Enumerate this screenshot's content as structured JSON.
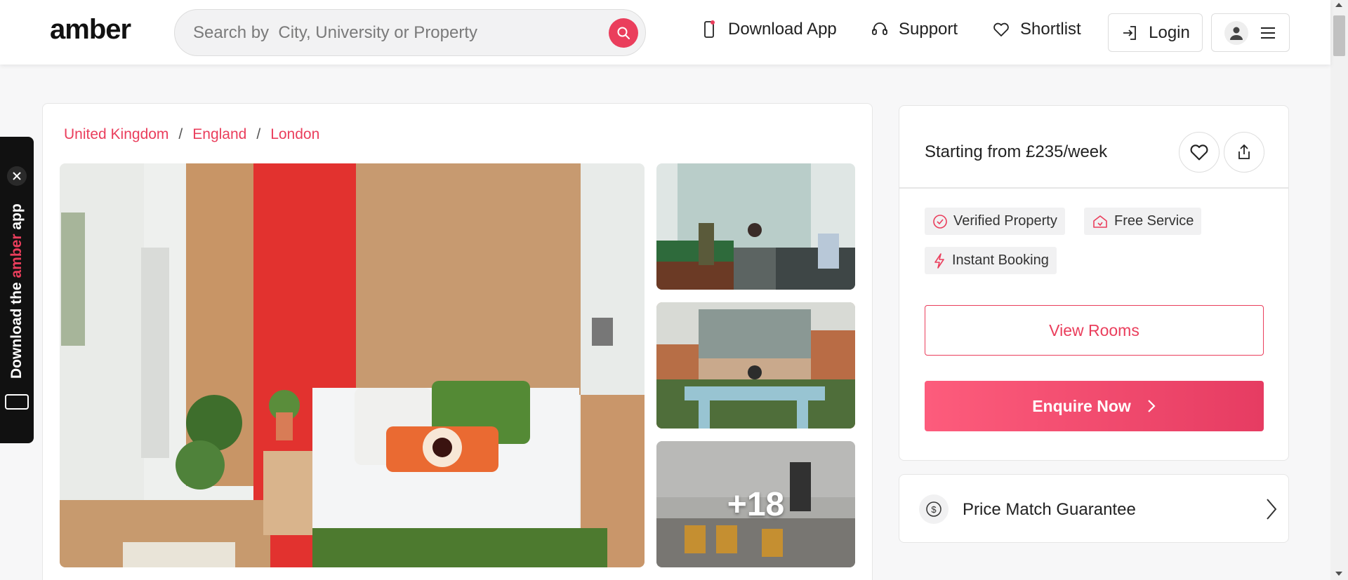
{
  "header": {
    "logo": "amber",
    "search_placeholder": "Search by  City, University or Property",
    "nav": {
      "download_app": "Download App",
      "support": "Support",
      "shortlist": "Shortlist",
      "login": "Login"
    }
  },
  "app_banner": {
    "text_prefix": "Download the ",
    "brand": "amber",
    "text_suffix": " app"
  },
  "breadcrumb": [
    "United Kingdom",
    "England",
    "London"
  ],
  "gallery": {
    "more_count": "+18"
  },
  "price_card": {
    "price_text": "Starting from £235/week",
    "tags": [
      "Verified Property",
      "Free Service",
      "Instant Booking"
    ],
    "view_rooms": "View Rooms",
    "enquire_now": "Enquire Now"
  },
  "price_match": {
    "label": "Price Match Guarantee"
  },
  "colors": {
    "accent": "#ea3e5c"
  }
}
